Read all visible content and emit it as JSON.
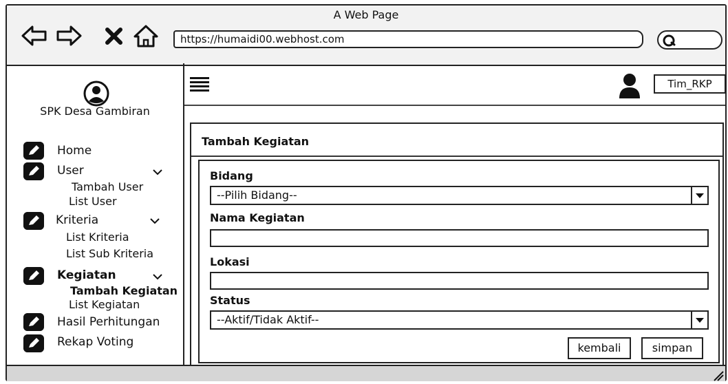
{
  "browser": {
    "title": "A Web Page",
    "url": "https://humaidi00.webhost.com"
  },
  "sidebar": {
    "brand": "SPK Desa Gambiran",
    "items": [
      {
        "label": "Home"
      },
      {
        "label": "User",
        "subitems": [
          "Tambah User",
          "List User"
        ]
      },
      {
        "label": "Kriteria",
        "subitems": [
          "List Kriteria",
          "List Sub Kriteria"
        ]
      },
      {
        "label": "Kegiatan",
        "active": true,
        "subitems": [
          "Tambah Kegiatan",
          "List Kegiatan"
        ]
      },
      {
        "label": "Hasil Perhitungan"
      },
      {
        "label": "Rekap Voting"
      }
    ]
  },
  "header": {
    "user_label": "Tim_RKP"
  },
  "form": {
    "title": "Tambah Kegiatan",
    "bidang_label": "Bidang",
    "bidang_value": "--Pilih Bidang--",
    "nama_label": "Nama Kegiatan",
    "nama_value": "",
    "lokasi_label": "Lokasi",
    "lokasi_value": "",
    "status_label": "Status",
    "status_value": "--Aktif/Tidak Aktif--",
    "back_label": "kembali",
    "save_label": "simpan"
  },
  "icons": {
    "back": "arrow-left-icon",
    "forward": "arrow-right-icon",
    "stop": "close-icon",
    "home": "home-icon",
    "search": "search-icon",
    "menu": "hamburger-icon",
    "user": "user-icon",
    "nav": "pencil-icon",
    "chevron": "chevron-down-icon"
  }
}
